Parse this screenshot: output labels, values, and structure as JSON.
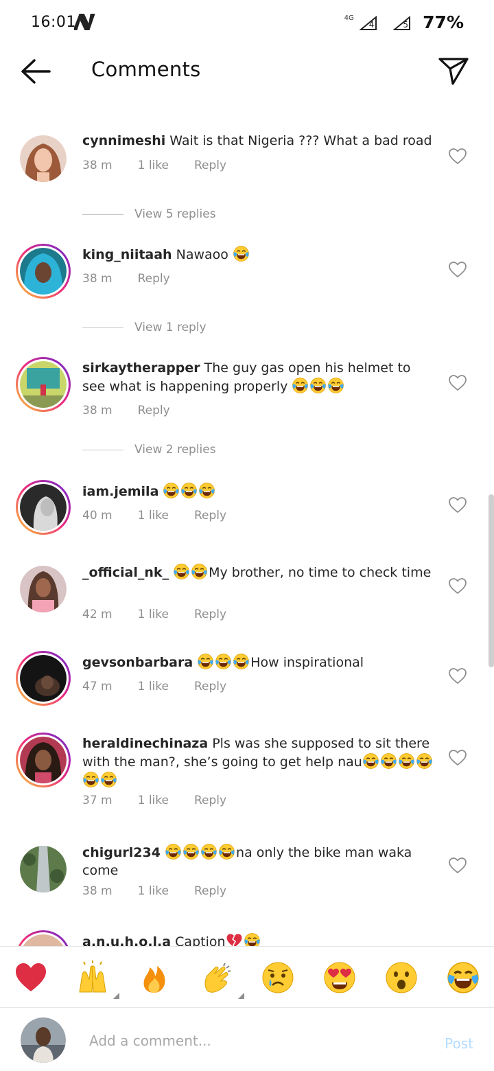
{
  "status_bar": {
    "time": "16:01",
    "carrier_icon": "n-logo-icon",
    "network_label": "4G",
    "sim_1": "4",
    "sim_2": "5",
    "battery": "77%"
  },
  "header": {
    "title": "Comments",
    "back_icon": "arrow-left-icon",
    "share_icon": "paper-plane-icon"
  },
  "comments": [
    {
      "username": "cynnimeshi",
      "text": "Wait is that Nigeria ??? What a bad road",
      "time": "38 m",
      "likes": "1 like",
      "reply": "Reply",
      "view_replies": "View 5 replies"
    },
    {
      "username": "king_niitaah",
      "text": "Nawaoo ",
      "emojis": 1,
      "time": "38 m",
      "likes": "",
      "reply": "Reply",
      "view_replies": "View 1 reply"
    },
    {
      "username": "sirkaytherapper",
      "text": "The guy gas open his helmet to see what is happening properly ",
      "emojis": 3,
      "time": "38 m",
      "likes": "",
      "reply": "Reply",
      "view_replies": "View 2 replies"
    },
    {
      "username": "iam.jemila",
      "text": "",
      "emojis": 3,
      "time": "40 m",
      "likes": "1 like",
      "reply": "Reply"
    },
    {
      "username": "_official_nk_",
      "text_pre_emoji": 2,
      "text": "My brother, no time to check time",
      "time": "42 m",
      "likes": "1 like",
      "reply": "Reply"
    },
    {
      "username": "gevsonbarbara",
      "text_pre_emoji": 3,
      "text": "How inspirational",
      "time": "47 m",
      "likes": "1 like",
      "reply": "Reply"
    },
    {
      "username": "heraldinechinaza",
      "text": "Pls was she supposed to sit there with the man?, she’s going to get help nau",
      "emojis": 6,
      "time": "37 m",
      "likes": "1 like",
      "reply": "Reply"
    },
    {
      "username": "chigurl234",
      "text_pre_emoji": 4,
      "text": "na only the bike man waka come",
      "time": "38 m",
      "likes": "1 like",
      "reply": "Reply"
    },
    {
      "username": "a.n.u.h.o.l.a",
      "text": "Caption",
      "time": "",
      "likes": "",
      "reply": ""
    }
  ],
  "reactions": [
    "red-heart-emoji",
    "raising-hands-emoji",
    "fire-emoji",
    "clapping-hands-emoji",
    "crying-face-emoji",
    "heart-eyes-emoji",
    "surprised-face-emoji",
    "tears-of-joy-emoji"
  ],
  "composer": {
    "placeholder": "Add a comment...",
    "post_label": "Post"
  },
  "colors": {
    "text": "#262626",
    "meta": "#8e8e8e",
    "post_disabled": "#b3dbff",
    "story_ring": "#ee2a7b"
  }
}
